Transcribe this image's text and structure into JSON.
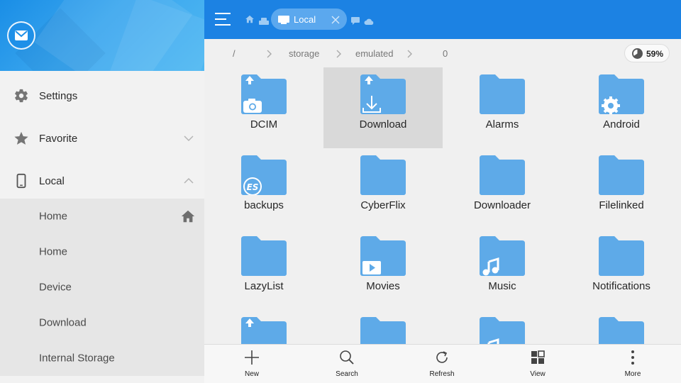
{
  "colors": {
    "accent": "#1c82e3",
    "folder": "#5eaae8",
    "selected_tile": "#d9d9d9"
  },
  "sidebar": {
    "header": {
      "avatar_icon": "mail-icon"
    },
    "items": [
      {
        "label": "Settings",
        "icon": "gear-icon"
      },
      {
        "label": "Favorite",
        "icon": "star-icon",
        "chevron": "chevron-down-icon"
      },
      {
        "label": "Local",
        "icon": "phone-icon",
        "chevron": "chevron-up-icon"
      }
    ],
    "local_children": [
      {
        "label": "Home",
        "icon": "home-icon"
      },
      {
        "label": "Home"
      },
      {
        "label": "Device"
      },
      {
        "label": "Download"
      },
      {
        "label": "Internal Storage"
      }
    ]
  },
  "topbar": {
    "menu_icon": "hamburger-icon",
    "tab": {
      "label": "Local",
      "icon": "storage-icon",
      "close_icon": "close-icon"
    },
    "extra_icons": [
      "home-icon",
      "network-icon",
      "message-icon",
      "cloud-icon"
    ]
  },
  "breadcrumb": {
    "segments": [
      "/",
      "storage",
      "emulated",
      "0"
    ],
    "usage": {
      "percent_label": "59%",
      "percent": 59
    }
  },
  "folders": [
    {
      "name": "DCIM",
      "badge": "camera",
      "pinned": true
    },
    {
      "name": "Download",
      "badge": "download",
      "pinned": true,
      "selected": true
    },
    {
      "name": "Alarms"
    },
    {
      "name": "Android",
      "badge": "gear"
    },
    {
      "name": "backups",
      "badge": "es"
    },
    {
      "name": "CyberFlix"
    },
    {
      "name": "Downloader"
    },
    {
      "name": "Filelinked"
    },
    {
      "name": "LazyList"
    },
    {
      "name": "Movies",
      "badge": "video"
    },
    {
      "name": "Music",
      "badge": "music"
    },
    {
      "name": "Notifications"
    }
  ],
  "bottombar": [
    {
      "label": "New",
      "icon": "plus-icon"
    },
    {
      "label": "Search",
      "icon": "search-icon"
    },
    {
      "label": "Refresh",
      "icon": "refresh-icon"
    },
    {
      "label": "View",
      "icon": "grid-view-icon"
    },
    {
      "label": "More",
      "icon": "more-vertical-icon"
    }
  ]
}
